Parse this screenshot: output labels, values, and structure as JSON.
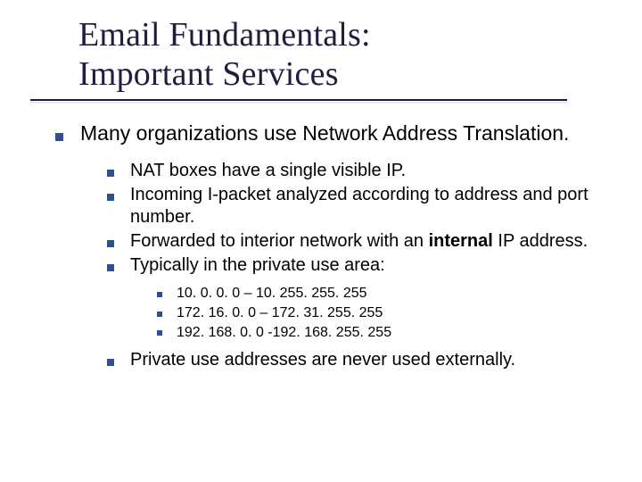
{
  "title_line1": "Email Fundamentals:",
  "title_line2": "Important Services",
  "level1": {
    "text": "Many organizations use Network Address Translation."
  },
  "level2": [
    {
      "text": "NAT boxes have a single visible IP."
    },
    {
      "text": "Incoming I-packet analyzed according to address and port number."
    },
    {
      "pre": "Forwarded to interior network with an ",
      "bold": "internal",
      "post": " IP address."
    },
    {
      "text": "Typically in the private use area:",
      "children": [
        "10. 0. 0. 0 – 10. 255. 255. 255",
        "172. 16. 0. 0 – 172. 31. 255. 255",
        "192. 168. 0. 0 -192. 168. 255. 255"
      ]
    },
    {
      "text": "Private use addresses are never used externally."
    }
  ]
}
